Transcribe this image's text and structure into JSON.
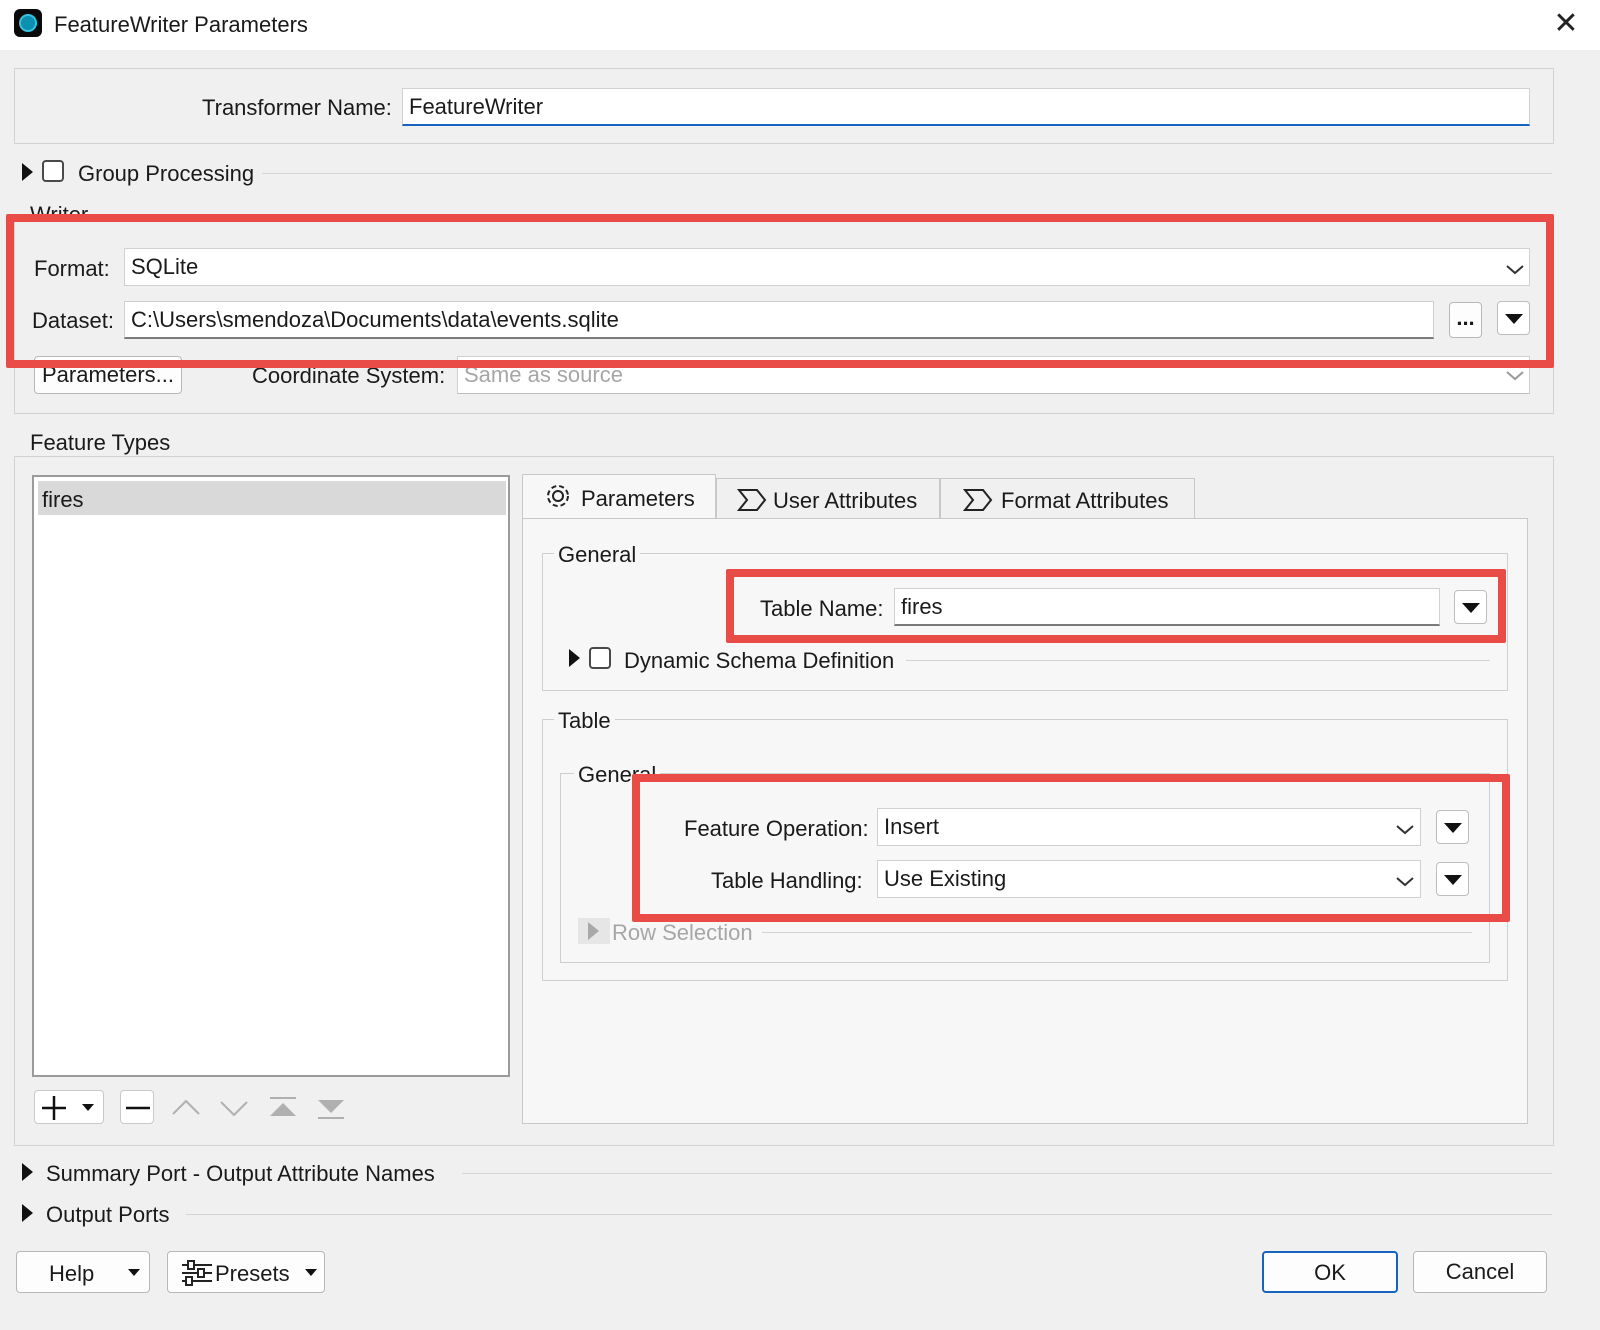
{
  "window": {
    "title": "FeatureWriter Parameters",
    "app_icon": "fme-icon",
    "close_icon": "close-icon"
  },
  "transformer": {
    "label": "Transformer Name:",
    "value": "FeatureWriter"
  },
  "group_processing": {
    "label": "Group Processing",
    "checked": false
  },
  "writer": {
    "section_label": "Writer",
    "format_label": "Format:",
    "format_value": "SQLite",
    "dataset_label": "Dataset:",
    "dataset_value": "C:\\Users\\smendoza\\Documents\\data\\events.sqlite",
    "browse_label": "...",
    "parameters_button": "Parameters...",
    "coord_label": "Coordinate System:",
    "coord_value": "Same as source"
  },
  "feature_types": {
    "section_label": "Feature Types",
    "items": [
      {
        "label": "fires",
        "selected": true
      }
    ],
    "toolbar_icons": [
      "add-icon",
      "remove-icon",
      "move-up-icon",
      "move-down-icon",
      "move-top-icon",
      "move-bottom-icon"
    ]
  },
  "tabs": [
    {
      "label": "Parameters",
      "icon": "gear-icon",
      "active": true
    },
    {
      "label": "User Attributes",
      "icon": "attribute-icon",
      "active": false
    },
    {
      "label": "Format Attributes",
      "icon": "attribute-icon",
      "active": false
    }
  ],
  "general": {
    "section_label": "General",
    "table_name_label": "Table Name:",
    "table_name_value": "fires",
    "dynamic_schema_label": "Dynamic Schema Definition",
    "dynamic_schema_checked": false
  },
  "table": {
    "section_label": "Table",
    "general_label": "General",
    "feature_operation_label": "Feature Operation:",
    "feature_operation_value": "Insert",
    "table_handling_label": "Table Handling:",
    "table_handling_value": "Use Existing",
    "row_selection_label": "Row Selection"
  },
  "collapsibles": {
    "summary_port": "Summary Port - Output Attribute Names",
    "output_ports": "Output Ports"
  },
  "footer": {
    "help": "Help",
    "presets": "Presets",
    "ok": "OK",
    "cancel": "Cancel"
  },
  "colors": {
    "highlight": "#e94b47",
    "focus_underline": "#1565c0",
    "ok_border": "#1565c0"
  }
}
